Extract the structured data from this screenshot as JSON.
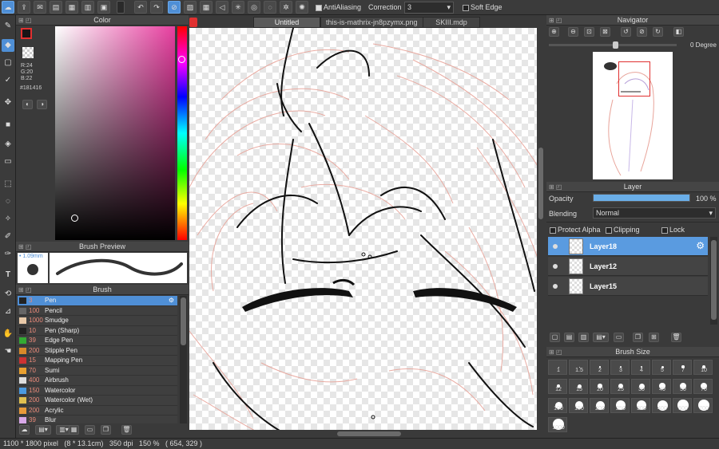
{
  "topbar": {
    "antialiasing_label": "AntiAliasing",
    "correction_label": "Correction",
    "correction_value": "3",
    "soft_edge_label": "Soft Edge"
  },
  "tabs": [
    {
      "label": "Untitled"
    },
    {
      "label": "this-is-mathrix-jn8pzymx.png"
    },
    {
      "label": "SKIII.mdp"
    }
  ],
  "color_panel": {
    "title": "Color",
    "r": "R:24",
    "g": "G:20",
    "b": "B:22",
    "hex": "#181416",
    "current_color": "#181416",
    "gradient_hue": "#e83fa0"
  },
  "brush_preview": {
    "title": "Brush Preview",
    "size": "1.09mm"
  },
  "brush_panel": {
    "title": "Brush",
    "items": [
      {
        "size": "3",
        "name": "Pen",
        "color": "#222222"
      },
      {
        "size": "100",
        "name": "Pencil",
        "color": "#666666"
      },
      {
        "size": "1000",
        "name": "Smudge",
        "color": "#e8c9a8"
      },
      {
        "size": "10",
        "name": "Pen (Sharp)",
        "color": "#222222"
      },
      {
        "size": "39",
        "name": "Edge Pen",
        "color": "#33aa33"
      },
      {
        "size": "200",
        "name": "Stipple Pen",
        "color": "#d98a2a"
      },
      {
        "size": "15",
        "name": "Mapping Pen",
        "color": "#cc3333"
      },
      {
        "size": "70",
        "name": "Sumi",
        "color": "#e8a030"
      },
      {
        "size": "400",
        "name": "Airbrush",
        "color": "#dddddd"
      },
      {
        "size": "150",
        "name": "Watercolor",
        "color": "#4a9ae0"
      },
      {
        "size": "200",
        "name": "Watercolor (Wet)",
        "color": "#e0c050"
      },
      {
        "size": "200",
        "name": "Acrylic",
        "color": "#e89a3a"
      },
      {
        "size": "39",
        "name": "Blur",
        "color": "#d8a8e8"
      }
    ]
  },
  "navigator": {
    "title": "Navigator",
    "rotation": "0 Degree"
  },
  "layer_panel": {
    "title": "Layer",
    "opacity_label": "Opacity",
    "opacity_value": "100 %",
    "opacity_fraction": 1.0,
    "blending_label": "Blending",
    "blending_value": "Normal",
    "protect_alpha_label": "Protect Alpha",
    "clipping_label": "Clipping",
    "lock_label": "Lock",
    "layers": [
      {
        "name": "Layer18",
        "selected": true
      },
      {
        "name": "Layer12",
        "selected": false
      },
      {
        "name": "Layer15",
        "selected": false
      }
    ]
  },
  "brush_size": {
    "title": "Brush Size",
    "sizes": [
      "1",
      "1.5",
      "2",
      "3",
      "4",
      "5",
      "7",
      "10",
      "12",
      "15",
      "20",
      "25",
      "30",
      "40",
      "50",
      "70",
      "100",
      "150",
      "200",
      "250",
      "300",
      "400",
      "500",
      "700",
      "1000"
    ]
  },
  "statusbar": {
    "text": "1100 * 1800 pixel   (8 * 13.1cm)   350 dpi   150 %   ( 654, 329 )"
  }
}
